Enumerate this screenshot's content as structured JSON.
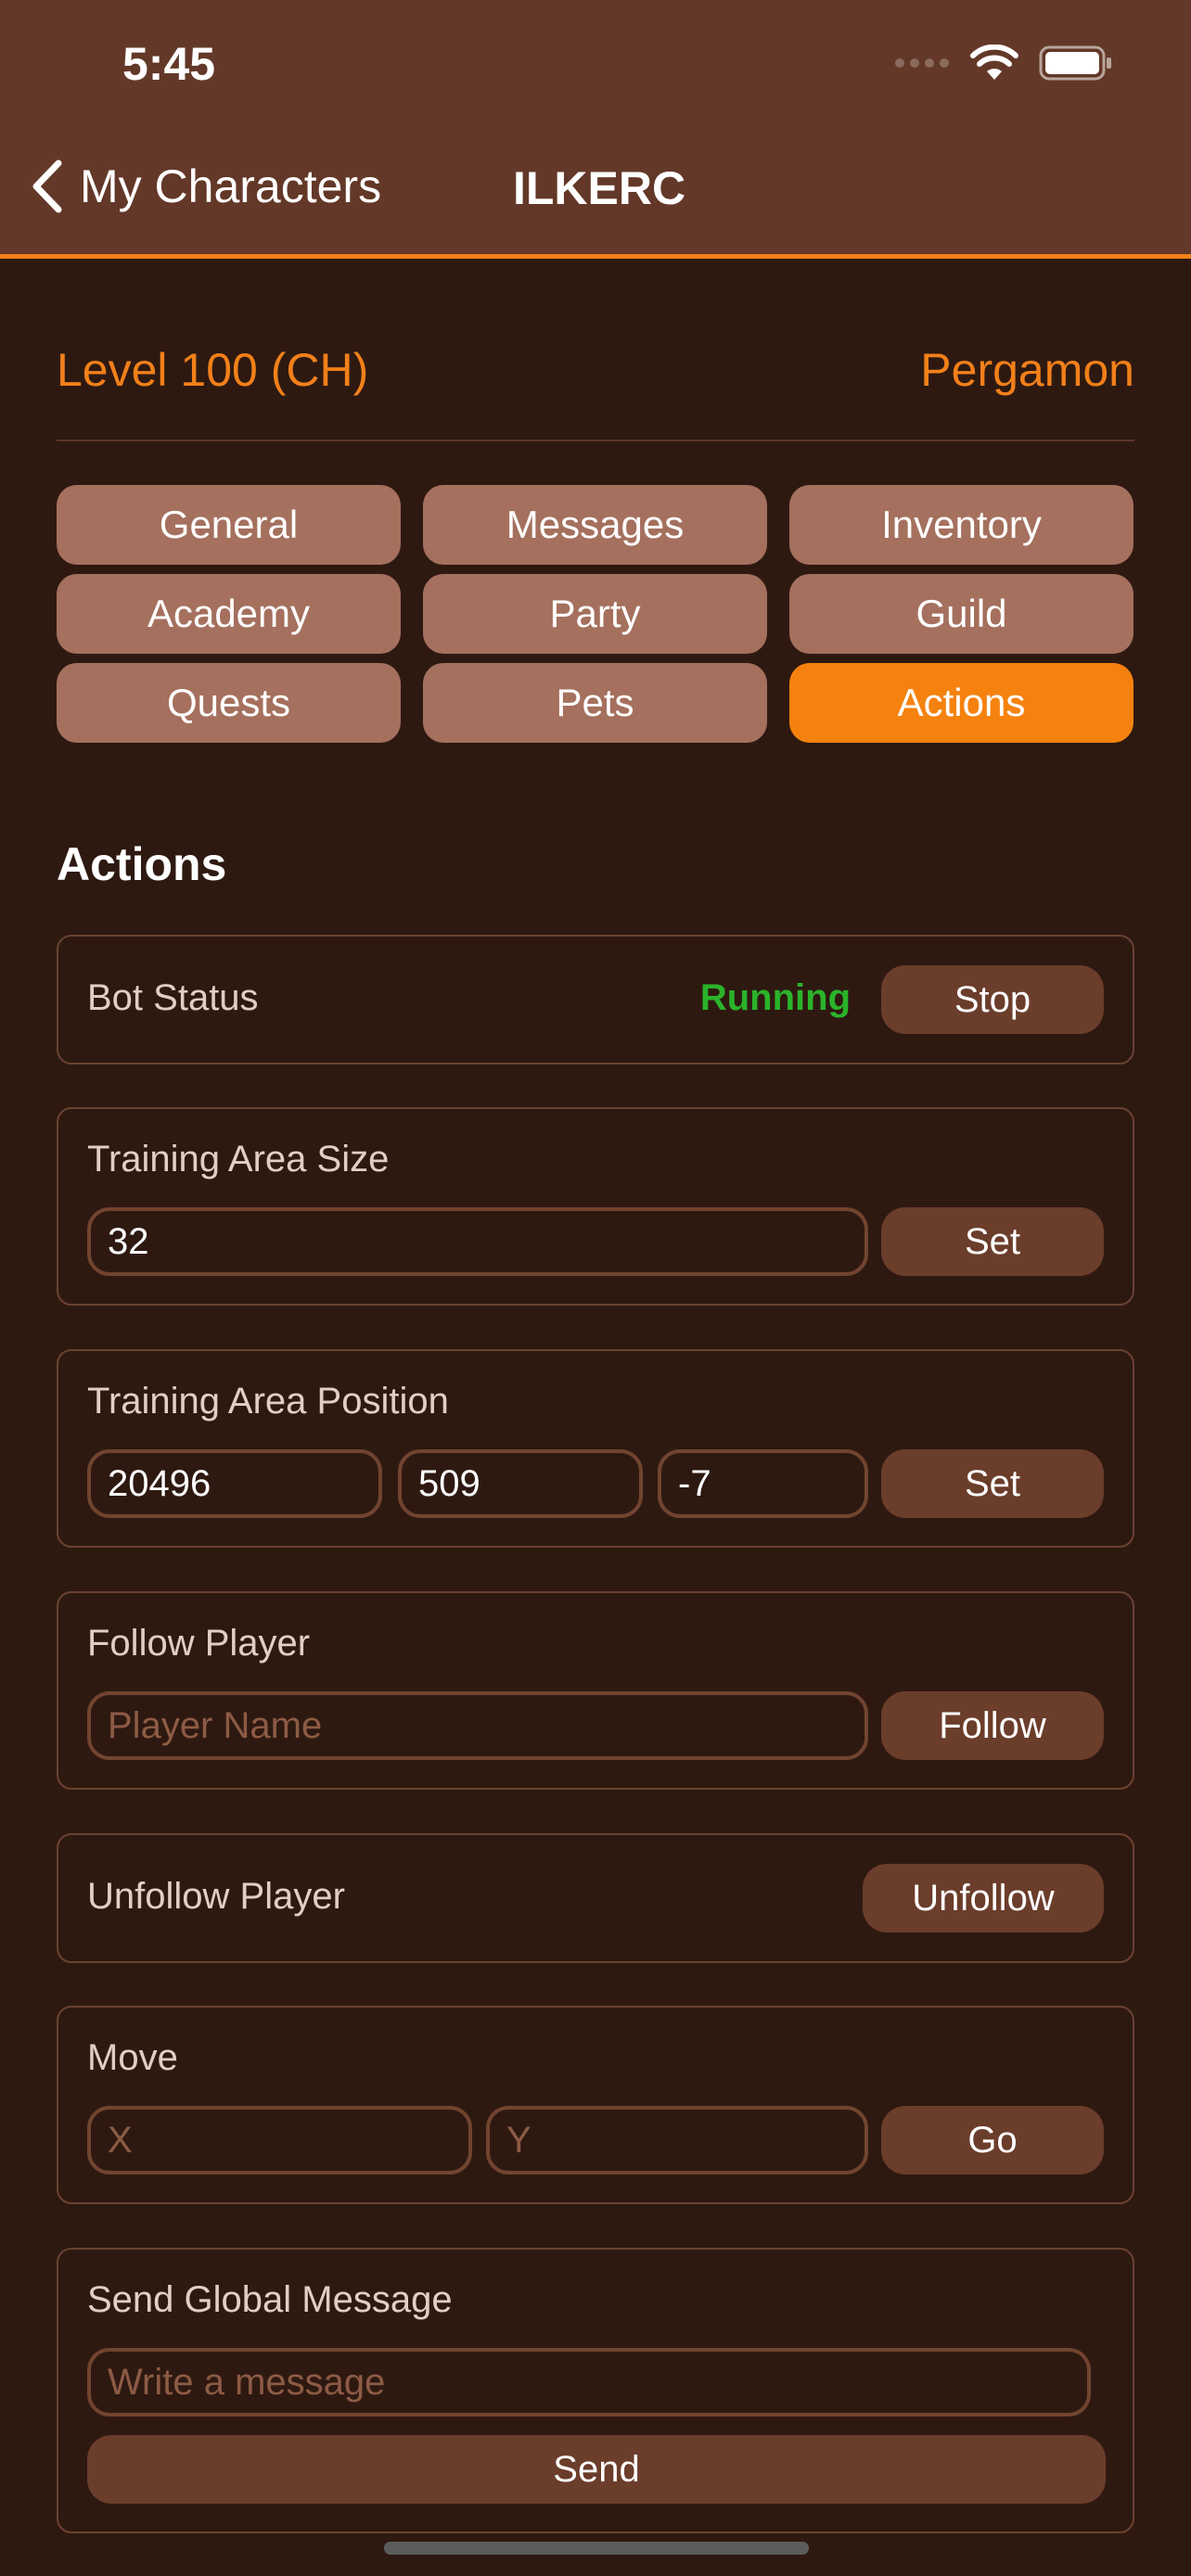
{
  "status_bar": {
    "time": "5:45"
  },
  "nav": {
    "back_label": "My Characters",
    "title": "ILKERC"
  },
  "character": {
    "level": "Level 100 (CH)",
    "server": "Pergamon"
  },
  "tabs": [
    {
      "label": "General",
      "active": false
    },
    {
      "label": "Messages",
      "active": false
    },
    {
      "label": "Inventory",
      "active": false
    },
    {
      "label": "Academy",
      "active": false
    },
    {
      "label": "Party",
      "active": false
    },
    {
      "label": "Guild",
      "active": false
    },
    {
      "label": "Quests",
      "active": false
    },
    {
      "label": "Pets",
      "active": false
    },
    {
      "label": "Actions",
      "active": true
    }
  ],
  "section_title": "Actions",
  "bot_status": {
    "label": "Bot Status",
    "value": "Running",
    "button": "Stop"
  },
  "training_area_size": {
    "label": "Training Area Size",
    "value": "32",
    "button": "Set"
  },
  "training_area_position": {
    "label": "Training Area Position",
    "x": "20496",
    "y": "509",
    "z": "-7",
    "button": "Set"
  },
  "follow_player": {
    "label": "Follow Player",
    "placeholder": "Player Name",
    "button": "Follow"
  },
  "unfollow_player": {
    "label": "Unfollow Player",
    "button": "Unfollow"
  },
  "move": {
    "label": "Move",
    "x_placeholder": "X",
    "y_placeholder": "Y",
    "button": "Go"
  },
  "global_message": {
    "label": "Send Global Message",
    "placeholder": "Write a message",
    "button": "Send"
  },
  "colors": {
    "accent": "#f5820f",
    "header_bg": "#633828",
    "page_bg": "#2e1911",
    "running": "#2ab32a"
  }
}
